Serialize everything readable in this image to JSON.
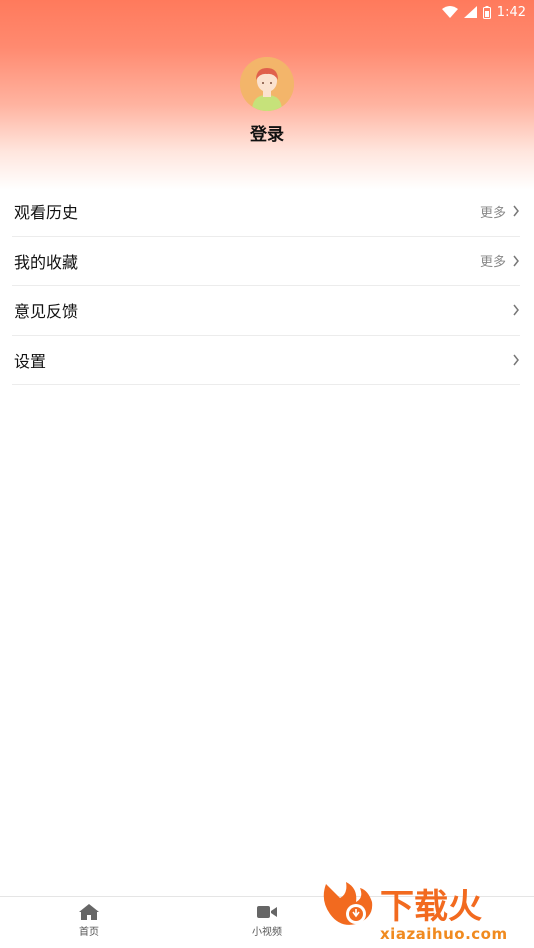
{
  "status_bar": {
    "time": "1:42"
  },
  "profile": {
    "login_label": "登录"
  },
  "menu": {
    "items": [
      {
        "label": "观看历史",
        "more": "更多"
      },
      {
        "label": "我的收藏",
        "more": "更多"
      },
      {
        "label": "意见反馈",
        "more": ""
      },
      {
        "label": "设置",
        "more": ""
      }
    ]
  },
  "bottom_nav": {
    "tabs": [
      {
        "label": "首页",
        "icon": "home-icon"
      },
      {
        "label": "小视频",
        "icon": "video-icon"
      }
    ]
  },
  "watermark": {
    "brand": "下载火",
    "site": "xiazaihuo.com"
  },
  "colors": {
    "header_top": "#ff7a5c",
    "accent": "#f08a1f"
  }
}
